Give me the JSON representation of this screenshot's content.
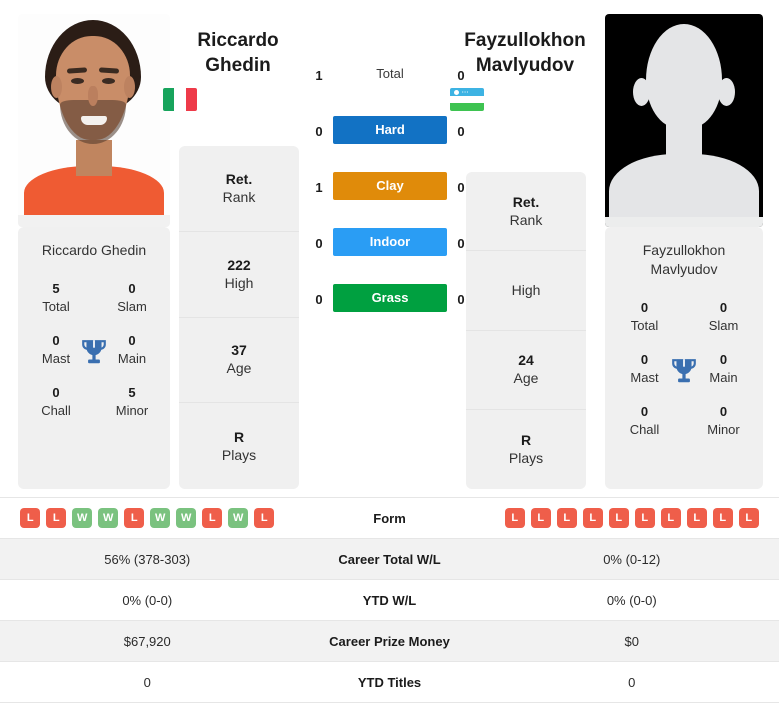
{
  "players": {
    "left": {
      "first_name": "Riccardo",
      "last_name": "Ghedin",
      "full_name": "Riccardo Ghedin",
      "country": "Italy",
      "flag_icon": "flag-italy",
      "photo": "player-photo",
      "rank": {
        "value": "Ret.",
        "label": "Rank"
      },
      "high": {
        "value": "222",
        "label": "High"
      },
      "age": {
        "value": "37",
        "label": "Age"
      },
      "plays": {
        "value": "R",
        "label": "Plays"
      },
      "titles": {
        "total": {
          "value": "5",
          "label": "Total"
        },
        "slam": {
          "value": "0",
          "label": "Slam"
        },
        "mast": {
          "value": "0",
          "label": "Mast"
        },
        "main": {
          "value": "0",
          "label": "Main"
        },
        "chall": {
          "value": "0",
          "label": "Chall"
        },
        "minor": {
          "value": "5",
          "label": "Minor"
        }
      },
      "form": [
        "L",
        "L",
        "W",
        "W",
        "L",
        "W",
        "W",
        "L",
        "W",
        "L"
      ],
      "career_total_wl": "56% (378-303)",
      "ytd_wl": "0% (0-0)",
      "career_prize_money": "$67,920",
      "ytd_titles": "0"
    },
    "right": {
      "first_name": "Fayzullokhon",
      "last_name": "Mavlyudov",
      "full_name": "Fayzullokhon Mavlyudov",
      "country": "Uzbekistan",
      "flag_icon": "flag-uzbekistan",
      "photo": "player-photo-placeholder",
      "rank": {
        "value": "Ret.",
        "label": "Rank"
      },
      "high": {
        "value": "",
        "label": "High"
      },
      "age": {
        "value": "24",
        "label": "Age"
      },
      "plays": {
        "value": "R",
        "label": "Plays"
      },
      "titles": {
        "total": {
          "value": "0",
          "label": "Total"
        },
        "slam": {
          "value": "0",
          "label": "Slam"
        },
        "mast": {
          "value": "0",
          "label": "Mast"
        },
        "main": {
          "value": "0",
          "label": "Main"
        },
        "chall": {
          "value": "0",
          "label": "Chall"
        },
        "minor": {
          "value": "0",
          "label": "Minor"
        }
      },
      "form": [
        "L",
        "L",
        "L",
        "L",
        "L",
        "L",
        "L",
        "L",
        "L",
        "L"
      ],
      "career_total_wl": "0% (0-12)",
      "ytd_wl": "0% (0-0)",
      "career_prize_money": "$0",
      "ytd_titles": "0"
    }
  },
  "head_to_head": [
    {
      "label": "Total",
      "left": "1",
      "right": "0",
      "color": "",
      "filled": false
    },
    {
      "label": "Hard",
      "left": "0",
      "right": "0",
      "color": "#1272c4",
      "filled": true
    },
    {
      "label": "Clay",
      "left": "1",
      "right": "0",
      "color": "#e08b0a",
      "filled": true
    },
    {
      "label": "Indoor",
      "left": "0",
      "right": "0",
      "color": "#2a9df4",
      "filled": true
    },
    {
      "label": "Grass",
      "left": "0",
      "right": "0",
      "color": "#00a040",
      "filled": true
    }
  ],
  "comparison_rows": [
    {
      "label": "Form",
      "left": "",
      "right": "",
      "type": "form"
    },
    {
      "label": "Career Total W/L",
      "left": "56% (378-303)",
      "right": "0% (0-12)",
      "type": "text"
    },
    {
      "label": "YTD W/L",
      "left": "0% (0-0)",
      "right": "0% (0-0)",
      "type": "text"
    },
    {
      "label": "Career Prize Money",
      "left": "$67,920",
      "right": "$0",
      "type": "text"
    },
    {
      "label": "YTD Titles",
      "left": "0",
      "right": "0",
      "type": "text"
    }
  ],
  "theme": {
    "card_bg": "#f0f0f0",
    "row_alt_bg": "#f2f2f2",
    "trophy_color": "#3a6fb0",
    "win_badge": "#7ac27f",
    "loss_badge": "#ef5e4a"
  }
}
